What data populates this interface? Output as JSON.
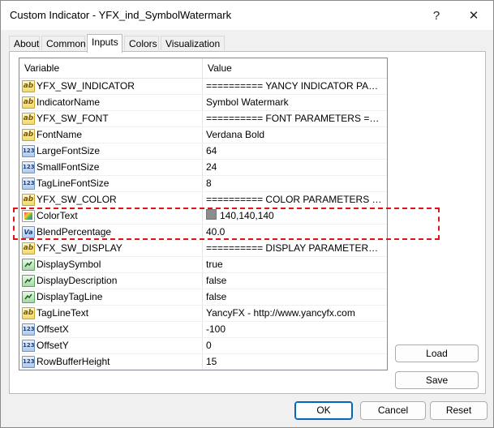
{
  "window": {
    "title": "Custom Indicator - YFX_ind_SymbolWatermark",
    "help_label": "?",
    "close_label": "✕"
  },
  "tabs": [
    {
      "label": "About"
    },
    {
      "label": "Common"
    },
    {
      "label": "Inputs",
      "active": true
    },
    {
      "label": "Colors"
    },
    {
      "label": "Visualization"
    }
  ],
  "grid": {
    "headers": {
      "variable": "Variable",
      "value": "Value"
    },
    "rows": [
      {
        "type": "string",
        "icon_text": "ab",
        "variable": "YFX_SW_INDICATOR",
        "value": "========== YANCY INDICATOR PARAMETERS =========="
      },
      {
        "type": "string",
        "icon_text": "ab",
        "variable": "IndicatorName",
        "value": "Symbol Watermark"
      },
      {
        "type": "string",
        "icon_text": "ab",
        "variable": "YFX_SW_FONT",
        "value": "========== FONT PARAMETERS =========="
      },
      {
        "type": "string",
        "icon_text": "ab",
        "variable": "FontName",
        "value": "Verdana Bold"
      },
      {
        "type": "int",
        "icon_text": "123",
        "variable": "LargeFontSize",
        "value": "64"
      },
      {
        "type": "int",
        "icon_text": "123",
        "variable": "SmallFontSize",
        "value": "24"
      },
      {
        "type": "int",
        "icon_text": "123",
        "variable": "TagLineFontSize",
        "value": "8"
      },
      {
        "type": "string",
        "icon_text": "ab",
        "variable": "YFX_SW_COLOR",
        "value": "========== COLOR PARAMETERS =========="
      },
      {
        "type": "color",
        "icon_text": "",
        "variable": "ColorText",
        "value": "140,140,140",
        "swatch": "#8c8c8c"
      },
      {
        "type": "double",
        "icon_text": "Va",
        "variable": "BlendPercentage",
        "value": "40.0"
      },
      {
        "type": "string",
        "icon_text": "ab",
        "variable": "YFX_SW_DISPLAY",
        "value": "========== DISPLAY PARAMETERS =========="
      },
      {
        "type": "bool",
        "icon_text": "",
        "variable": "DisplaySymbol",
        "value": "true"
      },
      {
        "type": "bool",
        "icon_text": "",
        "variable": "DisplayDescription",
        "value": "false"
      },
      {
        "type": "bool",
        "icon_text": "",
        "variable": "DisplayTagLine",
        "value": "false"
      },
      {
        "type": "string",
        "icon_text": "ab",
        "variable": "TagLineText",
        "value": "YancyFX - http://www.yancyfx.com"
      },
      {
        "type": "int",
        "icon_text": "123",
        "variable": "OffsetX",
        "value": "-100"
      },
      {
        "type": "int",
        "icon_text": "123",
        "variable": "OffsetY",
        "value": "0"
      },
      {
        "type": "int",
        "icon_text": "123",
        "variable": "RowBufferHeight",
        "value": "15"
      }
    ]
  },
  "side_buttons": {
    "load": "Load",
    "save": "Save"
  },
  "bottom_buttons": {
    "ok": "OK",
    "cancel": "Cancel",
    "reset": "Reset"
  },
  "colors": {
    "highlight": "#e0151b",
    "primary_border": "#0067c0"
  }
}
